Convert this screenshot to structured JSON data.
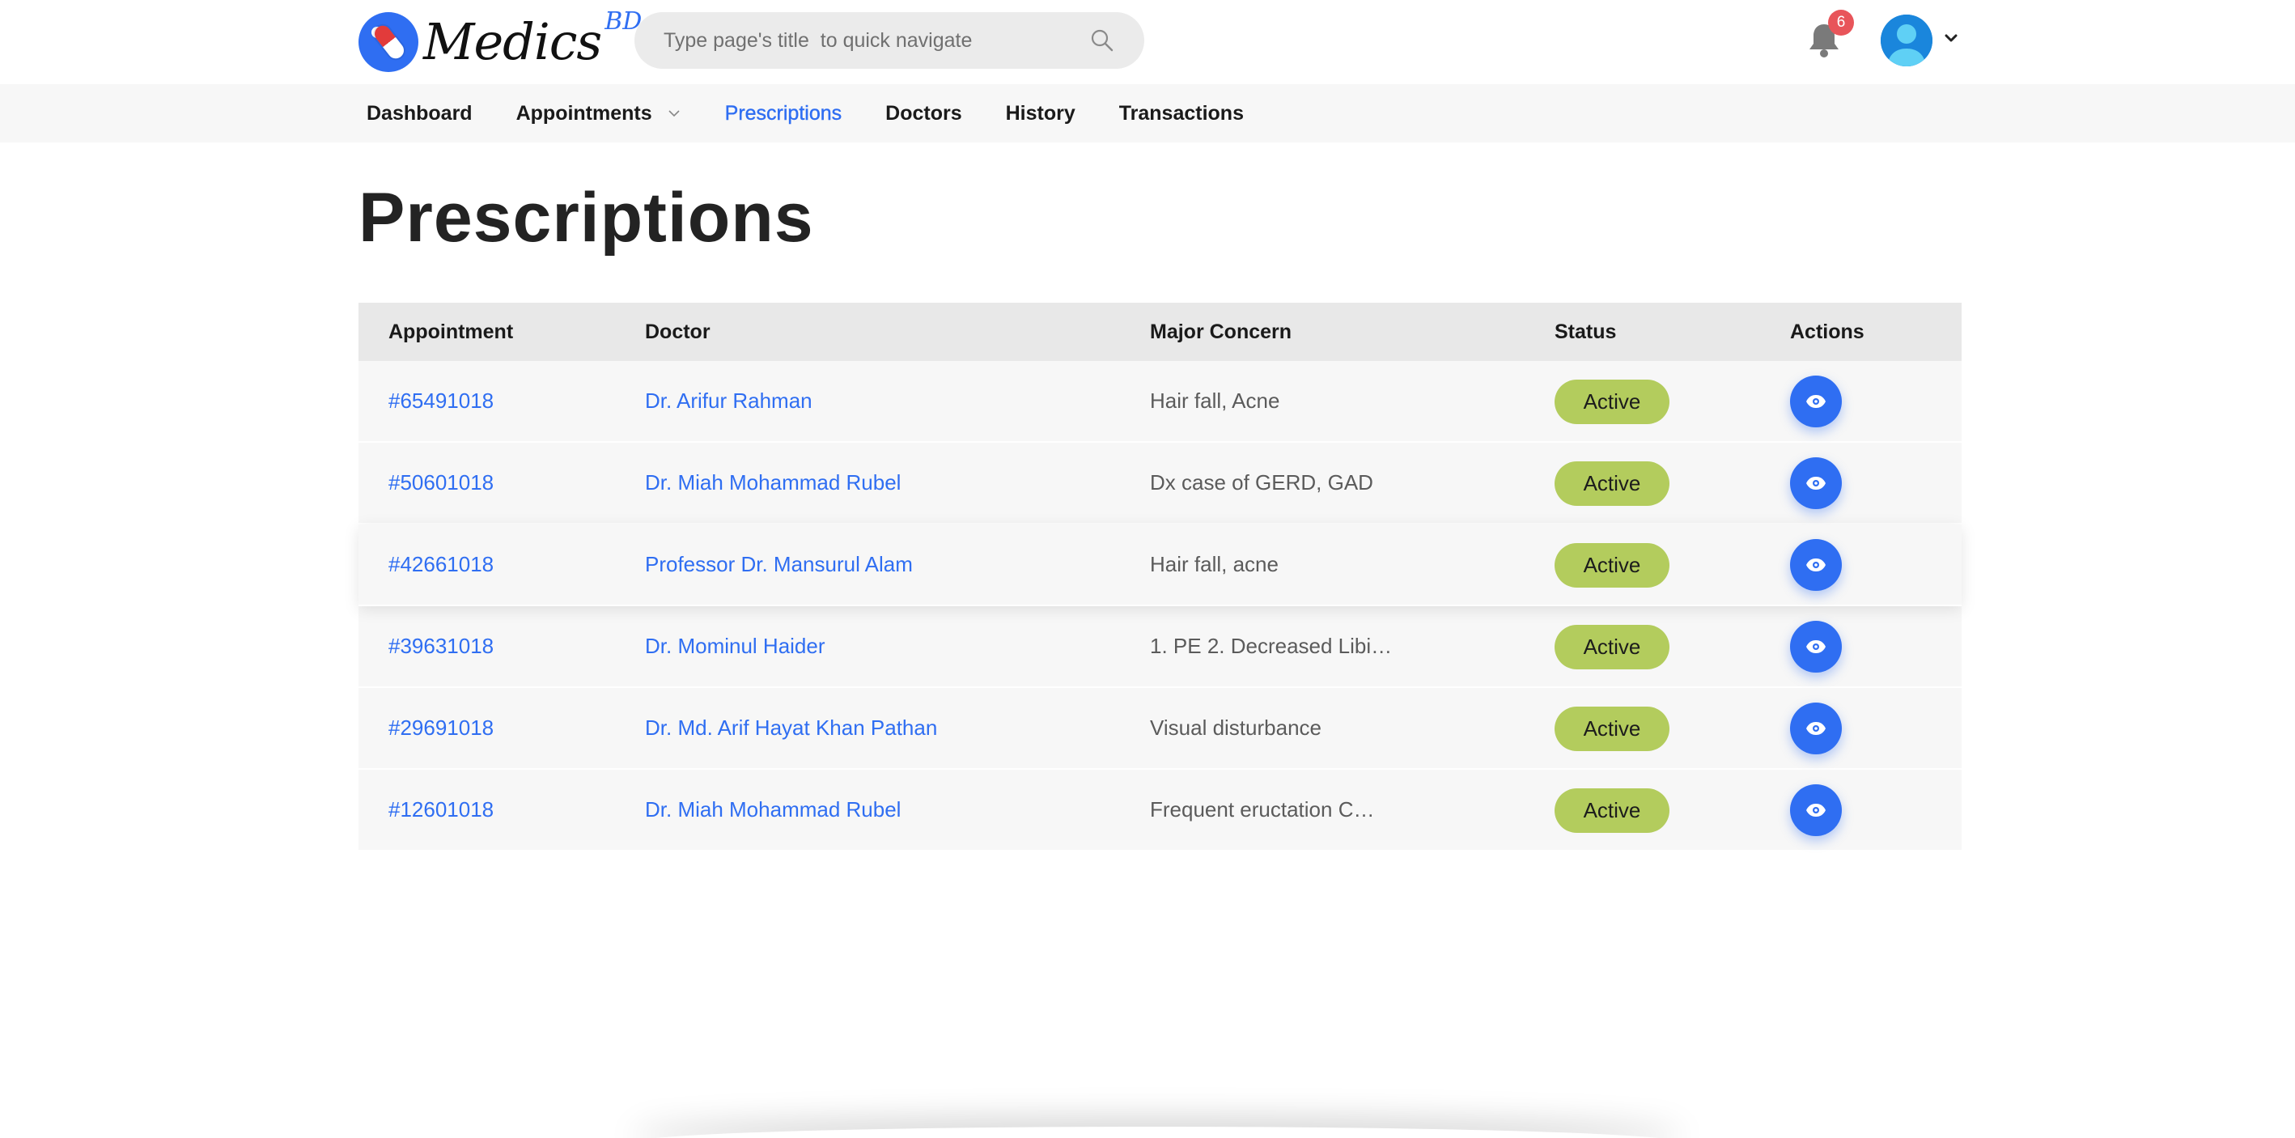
{
  "brand": {
    "name": "Medics",
    "suffix": "BD"
  },
  "search": {
    "placeholder": "Type page's title  to quick navigate"
  },
  "notifications": {
    "count": "6"
  },
  "nav": {
    "items": [
      {
        "label": "Dashboard"
      },
      {
        "label": "Appointments"
      },
      {
        "label": "Prescriptions"
      },
      {
        "label": "Doctors"
      },
      {
        "label": "History"
      },
      {
        "label": "Transactions"
      }
    ]
  },
  "page": {
    "title": "Prescriptions"
  },
  "table": {
    "headers": [
      "Appointment",
      "Doctor",
      "Major Concern",
      "Status",
      "Actions"
    ],
    "rows": [
      {
        "appointment": "#65491018",
        "doctor": "Dr. Arifur Rahman",
        "concern": "Hair fall, Acne",
        "status": "Active"
      },
      {
        "appointment": "#50601018",
        "doctor": "Dr. Miah Mohammad Rubel",
        "concern": "Dx case of GERD, GAD",
        "status": "Active"
      },
      {
        "appointment": "#42661018",
        "doctor": "Professor Dr. Mansurul Alam",
        "concern": "Hair fall, acne",
        "status": "Active"
      },
      {
        "appointment": "#39631018",
        "doctor": "Dr. Mominul Haider",
        "concern": "1. PE 2. Decreased Libi…",
        "status": "Active"
      },
      {
        "appointment": "#29691018",
        "doctor": "Dr. Md. Arif Hayat Khan Pathan",
        "concern": "Visual disturbance",
        "status": "Active"
      },
      {
        "appointment": "#12601018",
        "doctor": "Dr. Miah Mohammad Rubel",
        "concern": "Frequent eructation C…",
        "status": "Active"
      }
    ]
  },
  "colors": {
    "accent": "#2f6ef2",
    "status_active": "#b3cc5d",
    "badge": "#e8555a"
  },
  "icons": {
    "search": "search-icon",
    "bell": "bell-icon",
    "view": "eye-icon",
    "caret": "chevron-down-icon"
  }
}
